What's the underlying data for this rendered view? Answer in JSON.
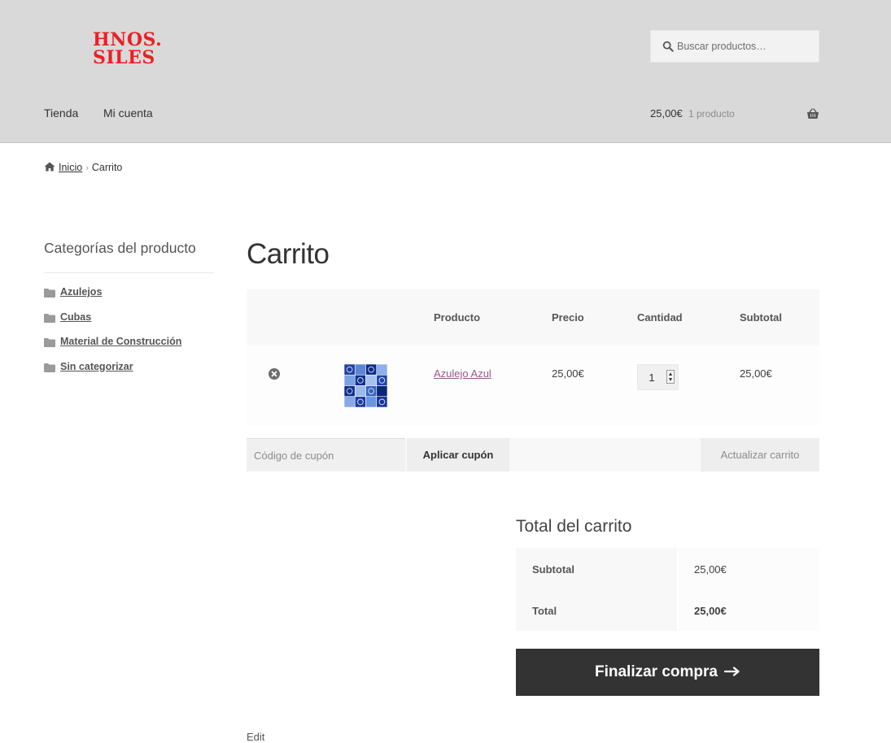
{
  "header": {
    "logo_line1": "HNOS.",
    "logo_line2": "SILES",
    "search_placeholder": "Buscar productos…",
    "nav": [
      "Tienda",
      "Mi cuenta"
    ],
    "cart_amount": "25,00€",
    "cart_count": "1 producto"
  },
  "breadcrumb": {
    "home": "Inicio",
    "current": "Carrito"
  },
  "sidebar": {
    "title": "Categorías del producto",
    "categories": [
      "Azulejos",
      "Cubas",
      "Material de Construcción",
      "Sin categorizar"
    ]
  },
  "page_title": "Carrito",
  "cart": {
    "headers": {
      "product": "Producto",
      "price": "Precio",
      "quantity": "Cantidad",
      "subtotal": "Subtotal"
    },
    "items": [
      {
        "name": "Azulejo Azul",
        "price": "25,00€",
        "quantity": "1",
        "subtotal": "25,00€"
      }
    ],
    "coupon_placeholder": "Código de cupón",
    "apply_coupon": "Aplicar cupón",
    "update_cart": "Actualizar carrito"
  },
  "totals": {
    "title": "Total del carrito",
    "subtotal_label": "Subtotal",
    "subtotal_value": "25,00€",
    "total_label": "Total",
    "total_value": "25,00€",
    "checkout": "Finalizar compra"
  },
  "footer_peek": "Edit",
  "colors": {
    "header_bg": "#d9d9d9",
    "logo_red": "#ee1f24",
    "product_link": "#96588a",
    "checkout_bg": "#333333"
  }
}
